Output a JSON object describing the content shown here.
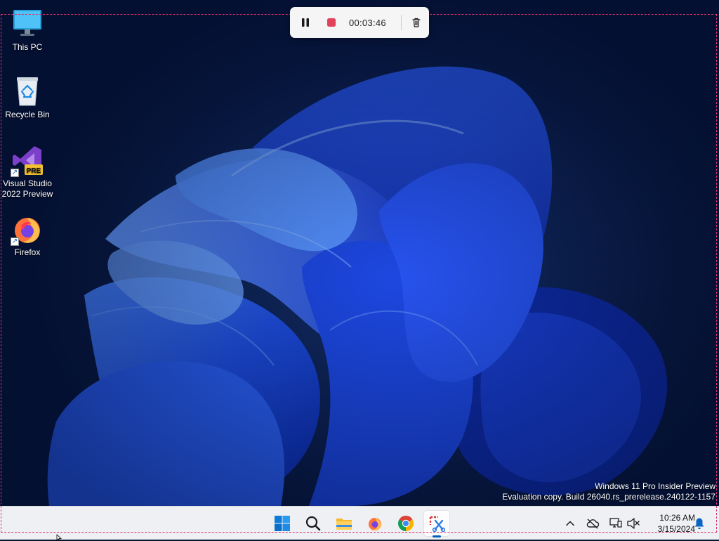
{
  "desktop": {
    "icons": [
      {
        "name": "This PC",
        "label": "This PC"
      },
      {
        "name": "Recycle Bin",
        "label": "Recycle Bin"
      },
      {
        "name": "Visual Studio 2022 Preview",
        "label": "Visual Studio 2022 Preview",
        "badge": "PRE"
      },
      {
        "name": "Firefox",
        "label": "Firefox"
      }
    ],
    "watermark": {
      "line1": "Windows 11 Pro Insider Preview",
      "line2": "Evaluation copy. Build 26040.rs_prerelease.240122-1157"
    }
  },
  "recording_bar": {
    "time": "00:03:46",
    "icons": [
      "pause-icon",
      "stop-icon",
      "delete-icon"
    ]
  },
  "taskbar": {
    "apps": [
      "start-icon",
      "search-icon",
      "file-explorer-icon",
      "firefox-icon",
      "chrome-icon",
      "snipping-tool-icon"
    ],
    "active_app": "snipping-tool-icon",
    "tray": {
      "icons": [
        "chevron-up-icon",
        "onedrive-offline-icon",
        "network-icon",
        "volume-muted-icon",
        "notification-bell-icon"
      ],
      "time": "10:26 AM",
      "date": "3/15/2024"
    }
  },
  "colors": {
    "accent": "#005fb8",
    "record_red": "#e0435a",
    "wallpaper_blue": "#1f4fe0"
  }
}
